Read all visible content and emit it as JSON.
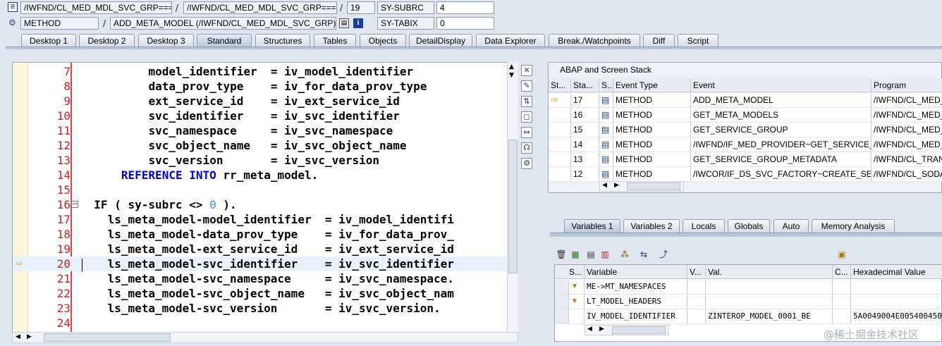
{
  "header": {
    "row1": {
      "program1": "/IWFND/CL_MED_MDL_SVC_GRP====...",
      "program2": "/IWFND/CL_MED_MDL_SVC_GRP====...",
      "line": "19",
      "field_name": "SY-SUBRC",
      "field_value": "4"
    },
    "row2": {
      "event_type": "METHOD",
      "event": "ADD_META_MODEL (/IWFND/CL_MED_MDL_SVC_GRP)",
      "field_name": "SY-TABIX",
      "field_value": "0"
    }
  },
  "tabs": [
    "Desktop 1",
    "Desktop 2",
    "Desktop 3",
    "Standard",
    "Structures",
    "Tables",
    "Objects",
    "DetailDisplay",
    "Data Explorer",
    "Break./Watchpoints",
    "Diff",
    "Script"
  ],
  "active_tab": "Standard",
  "code": [
    {
      "n": "7",
      "text": "model_identifier  = iv_model_identifier",
      "indent": 10
    },
    {
      "n": "8",
      "text": "data_prov_type    = iv_for_data_prov_type",
      "indent": 10
    },
    {
      "n": "9",
      "text": "ext_service_id    = iv_ext_service_id",
      "indent": 10
    },
    {
      "n": "10",
      "text": "svc_identifier    = iv_svc_identifier",
      "indent": 10
    },
    {
      "n": "11",
      "text": "svc_namespace     = iv_svc_namespace",
      "indent": 10
    },
    {
      "n": "12",
      "text": "svc_object_name   = iv_svc_object_name",
      "indent": 10
    },
    {
      "n": "13",
      "text": "svc_version       = iv_svc_version",
      "indent": 10
    },
    {
      "n": "14",
      "kw1": "REFERENCE",
      "kw2": "INTO",
      "text": " rr_meta_model.",
      "indent": 6
    },
    {
      "n": "15",
      "text": "",
      "indent": 0
    },
    {
      "n": "16",
      "pre": "IF ( sy-subrc <> ",
      "num": "0",
      "post": " ).",
      "indent": 2
    },
    {
      "n": "17",
      "text": "ls_meta_model-model_identifier  = iv_model_identifi",
      "indent": 4
    },
    {
      "n": "18",
      "text": "ls_meta_model-data_prov_type    = iv_for_data_prov_",
      "indent": 4
    },
    {
      "n": "19",
      "text": "ls_meta_model-ext_service_id    = iv_ext_service_id",
      "indent": 4
    },
    {
      "n": "20",
      "text": "ls_meta_model-svc_identifier    = iv_svc_identifier",
      "indent": 4
    },
    {
      "n": "21",
      "text": "ls_meta_model-svc_namespace     = iv_svc_namespace.",
      "indent": 4
    },
    {
      "n": "22",
      "text": "ls_meta_model-svc_object_name   = iv_svc_object_nam",
      "indent": 4
    },
    {
      "n": "23",
      "text": "ls_meta_model-svc_version       = iv_svc_version.",
      "indent": 4
    },
    {
      "n": "24",
      "text": "",
      "indent": 0
    }
  ],
  "stack": {
    "title": "ABAP and Screen Stack",
    "columns": [
      "St...",
      "Sta...",
      "S..",
      "Event Type",
      "Event",
      "Program"
    ],
    "rows": [
      {
        "level": "17",
        "type": "METHOD",
        "event": "ADD_META_MODEL",
        "program": "/IWFND/CL_MED_",
        "current": true
      },
      {
        "level": "16",
        "type": "METHOD",
        "event": "GET_META_MODELS",
        "program": "/IWFND/CL_MED_"
      },
      {
        "level": "15",
        "type": "METHOD",
        "event": "GET_SERVICE_GROUP",
        "program": "/IWFND/CL_MED_"
      },
      {
        "level": "14",
        "type": "METHOD",
        "event": "/IWFND/IF_MED_PROVIDER~GET_SERVICE_...",
        "program": "/IWFND/CL_MED_"
      },
      {
        "level": "13",
        "type": "METHOD",
        "event": "GET_SERVICE_GROUP_METADATA",
        "program": "/IWFND/CL_TRAN"
      },
      {
        "level": "12",
        "type": "METHOD",
        "event": "/IWCOR/IF_DS_SVC_FACTORY~CREATE_SE...",
        "program": "/IWFND/CL_SODA"
      }
    ]
  },
  "var_tabs": [
    "Variables 1",
    "Variables 2",
    "Locals",
    "Globals",
    "Auto",
    "Memory Analysis"
  ],
  "active_var_tab": "Variables 1",
  "variables": {
    "columns": [
      "S...",
      "Variable",
      "V...",
      "Val.",
      "C...",
      "Hexadecimal Value"
    ],
    "rows": [
      {
        "variable": "ME->MT_NAMESPACES",
        "value": "",
        "hex": "",
        "icon": true
      },
      {
        "variable": "LT_MODEL_HEADERS",
        "value": "",
        "hex": "",
        "icon": true
      },
      {
        "variable": "IV_MODEL_IDENTIFIER",
        "value": "ZINTEROP_MODEL_0001_BE",
        "hex": "5A0049004E005400450",
        "icon": false
      }
    ]
  },
  "watermark": "@稀土掘金技术社区"
}
